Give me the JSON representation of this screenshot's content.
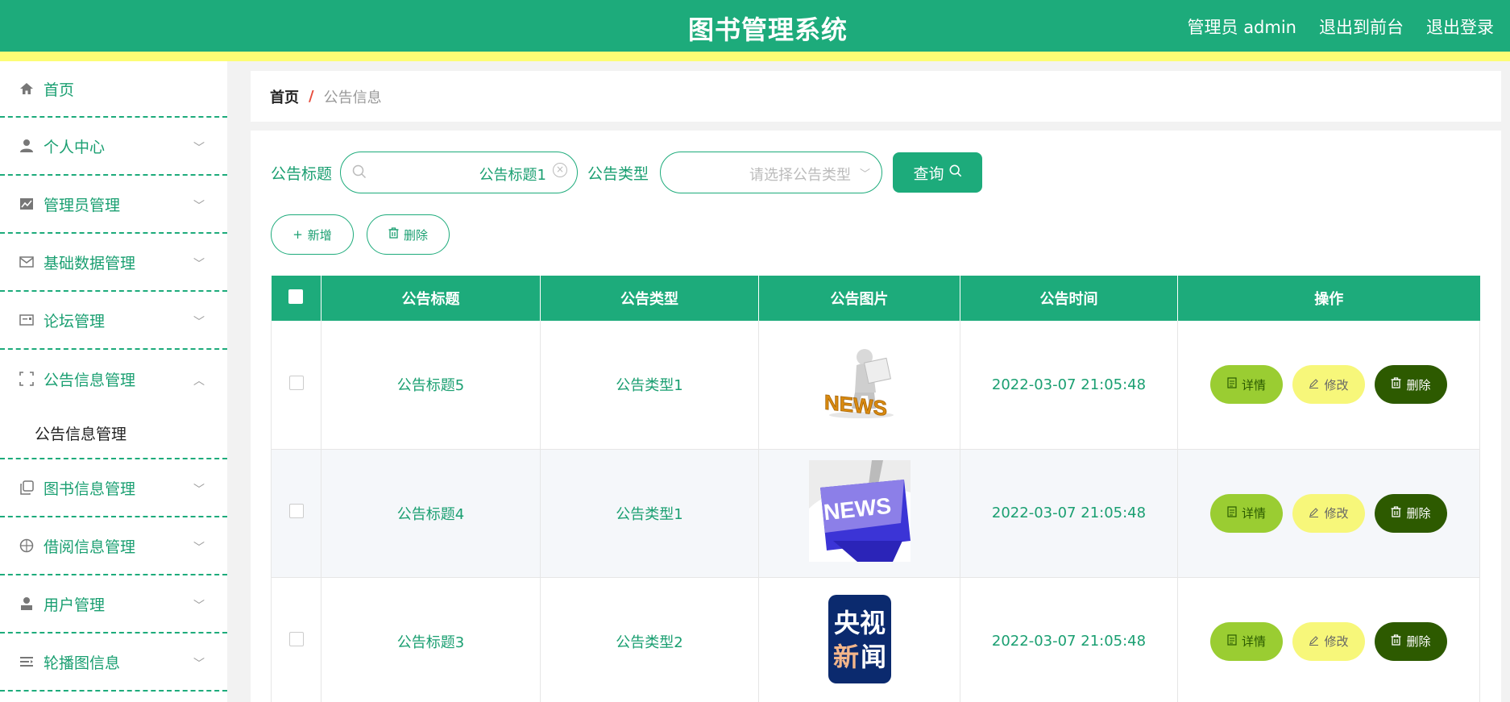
{
  "header": {
    "title": "图书管理系统",
    "admin_label": "管理员 admin",
    "to_front": "退出到前台",
    "logout": "退出登录"
  },
  "sidebar": {
    "items": [
      {
        "label": "首页",
        "icon": "home-icon"
      },
      {
        "label": "个人中心",
        "icon": "user-icon"
      },
      {
        "label": "管理员管理",
        "icon": "chart-icon"
      },
      {
        "label": "基础数据管理",
        "icon": "mail-icon"
      },
      {
        "label": "论坛管理",
        "icon": "card-icon"
      },
      {
        "label": "公告信息管理",
        "icon": "frame-icon"
      },
      {
        "label": "图书信息管理",
        "icon": "copy-icon"
      },
      {
        "label": "借阅信息管理",
        "icon": "compass-icon"
      },
      {
        "label": "用户管理",
        "icon": "person-icon"
      },
      {
        "label": "轮播图信息",
        "icon": "list-icon"
      }
    ],
    "submenu_label": "公告信息管理"
  },
  "breadcrumb": {
    "home": "首页",
    "separator": "/",
    "current": "公告信息"
  },
  "search": {
    "title_label": "公告标题",
    "title_value": "公告标题1",
    "type_label": "公告类型",
    "type_placeholder": "请选择公告类型",
    "query_label": "查询"
  },
  "actions": {
    "add_label": "新增",
    "delete_label": "删除"
  },
  "table": {
    "headers": [
      "公告标题",
      "公告类型",
      "公告图片",
      "公告时间",
      "操作"
    ],
    "rows": [
      {
        "title": "公告标题5",
        "type": "公告类型1",
        "image": "news-figure-image",
        "time": "2022-03-07 21:05:48"
      },
      {
        "title": "公告标题4",
        "type": "公告类型1",
        "image": "news-keyboard-image",
        "time": "2022-03-07 21:05:48"
      },
      {
        "title": "公告标题3",
        "type": "公告类型2",
        "image": "cctv-news-logo",
        "time": "2022-03-07 21:05:48"
      }
    ],
    "op_detail": "详情",
    "op_edit": "修改",
    "op_delete": "删除"
  },
  "images": {
    "news_text": "NEWS",
    "cctv_line1": "央视",
    "cctv_line2a": "新",
    "cctv_line2b": "闻"
  },
  "colors": {
    "primary": "#1dab7b",
    "stripe": "#fdfd75",
    "detail_btn": "#9acd32",
    "edit_btn": "#f7f77a",
    "delete_btn": "#2d5a00"
  }
}
